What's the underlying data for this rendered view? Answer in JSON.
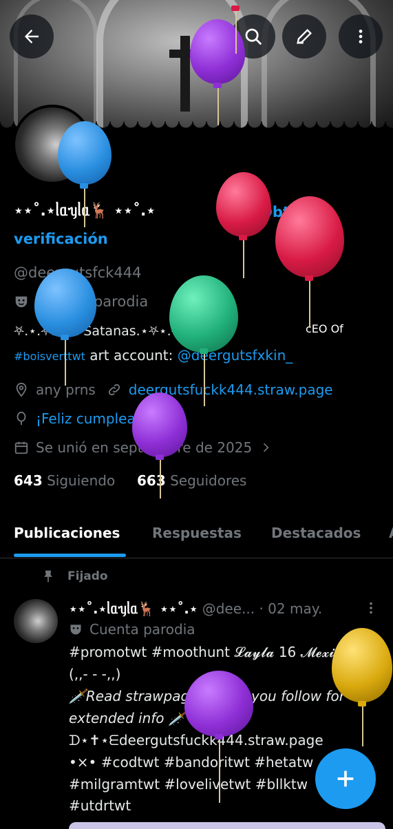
{
  "profile": {
    "name": "⋆⋆˚.⋆ᥣᥲᥡᥣᥲ🦌 ⋆⋆˚.⋆",
    "verify_label_1": "Obtén la",
    "verify_label_2": "verificación",
    "handle": "@deergutsfck444",
    "parody_label": "Cuenta parodia",
    "bio_line1": "⛧.⋆.⛧.Ave Satanas.⋆⛧⋆.⛧",
    "bio_tag": "#boisverttwt",
    "bio_text": " art account: ",
    "bio_link": "@deergutsfxkin_",
    "pronouns": "any prns",
    "website": "deergutsfuckk444.straw.page",
    "birthday": "¡Feliz cumpleaños!",
    "joined": "Se unió en septiembre de 2025",
    "following_count": "643",
    "following_label": "Siguiendo",
    "followers_count": "663",
    "followers_label": "Seguidores"
  },
  "tabs": [
    {
      "label": "Publicaciones"
    },
    {
      "label": "Respuestas"
    },
    {
      "label": "Destacados"
    },
    {
      "label": "A"
    }
  ],
  "pinned_label": "Fijado",
  "post": {
    "name": "⋆⋆˚.⋆ᥣᥲᥡᥣᥲ🦌 ⋆⋆˚.⋆",
    "handle": "@dee...",
    "time": "· 02 may.",
    "parody": "Cuenta parodia",
    "line1": "#promotwt #moothunt 𝓛𝓪𝔂𝓵𝓪 16 𝓜𝓮𝔁𝓲𝓬𝓪𝓷",
    "line2": "(,,- - -,,)",
    "line3": "🗡️Read strawpage before you follow for",
    "line4": "extended info 🗡️",
    "line5": "ᗪ⋆✝⋆ᗴdeergutsfuckk444.straw.page",
    "line6": "•×• #codtwt  #bandoritwt #hetatw",
    "line7": "#milgramtwt #lovelivetwt #bllktw",
    "line8": "#utdrtwt"
  },
  "overlay_text": "cEO Of",
  "icons": [
    "back-arrow-icon",
    "search-icon",
    "edit-icon",
    "more-vertical-icon",
    "verified-icon",
    "theater-masks-icon",
    "location-icon",
    "link-icon",
    "balloon-icon",
    "calendar-icon",
    "chevron-right-icon",
    "pin-icon",
    "plus-icon"
  ],
  "colors": {
    "accent": "#1d9bf0",
    "balloon_blue": "#2a8fe0",
    "balloon_purple": "#8e2fd6",
    "balloon_red": "#d81b45",
    "balloon_green": "#21b07a",
    "balloon_gold": "#d9a90e"
  }
}
